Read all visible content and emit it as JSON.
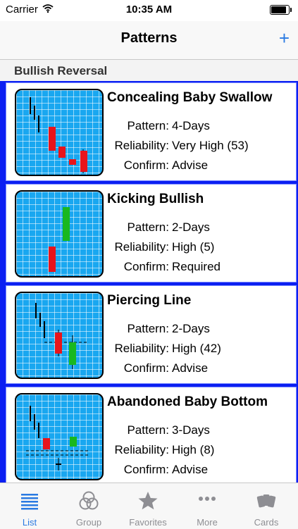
{
  "status": {
    "carrier": "Carrier",
    "time": "10:35 AM",
    "battery_level": 0.95
  },
  "nav": {
    "title": "Patterns",
    "add_label": "+"
  },
  "section": {
    "title": "Bullish Reversal"
  },
  "labels": {
    "pattern": "Pattern:",
    "reliability": "Reliability:",
    "confirm": "Confirm:"
  },
  "patterns": [
    {
      "name": "Concealing Baby Swallow",
      "pattern": "4-Days",
      "reliability": "Very High (53)",
      "confirm": "Advise"
    },
    {
      "name": "Kicking Bullish",
      "pattern": "2-Days",
      "reliability": "High (5)",
      "confirm": "Required"
    },
    {
      "name": "Piercing Line",
      "pattern": "2-Days",
      "reliability": "High (42)",
      "confirm": "Advise"
    },
    {
      "name": "Abandoned Baby Bottom",
      "pattern": "3-Days",
      "reliability": "High (8)",
      "confirm": "Advise"
    }
  ],
  "tabs": [
    {
      "label": "List",
      "icon": "list-icon",
      "active": true
    },
    {
      "label": "Group",
      "icon": "group-icon",
      "active": false
    },
    {
      "label": "Favorites",
      "icon": "star-icon",
      "active": false
    },
    {
      "label": "More",
      "icon": "more-icon",
      "active": false
    },
    {
      "label": "Cards",
      "icon": "cards-icon",
      "active": false
    }
  ],
  "colors": {
    "accent": "#2a7ae2",
    "list_bg": "#0b1ff2",
    "chart_bg": "#19a7f0",
    "bear": "#e8141b",
    "bull": "#19b81f"
  }
}
